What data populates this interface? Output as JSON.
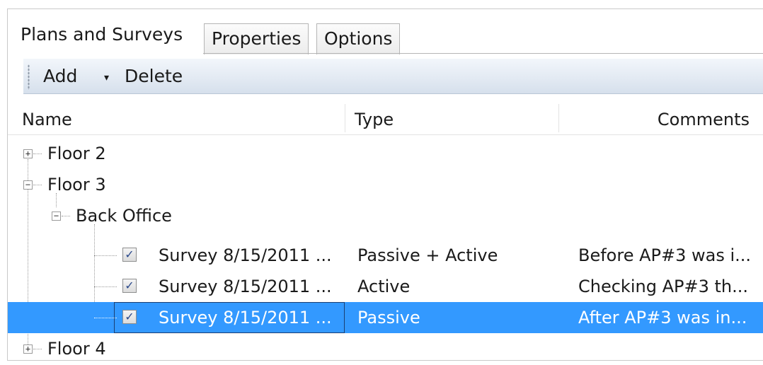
{
  "tabs": [
    {
      "label": "Plans and Surveys",
      "active": true
    },
    {
      "label": "Properties",
      "active": false
    },
    {
      "label": "Options",
      "active": false
    }
  ],
  "toolbar": {
    "add_label": "Add",
    "add_caret": "▾",
    "delete_label": "Delete"
  },
  "columns": {
    "name": "Name",
    "type": "Type",
    "comments": "Comments"
  },
  "tree": {
    "floor2": {
      "name": "Floor 2",
      "expander": "+"
    },
    "floor3": {
      "name": "Floor 3",
      "expander": "−"
    },
    "back_office": {
      "name": "Back Office",
      "expander": "−"
    },
    "surveys": [
      {
        "name": "Survey 8/15/2011 ...",
        "type": "Passive + Active",
        "comments": "Before AP#3 was i...",
        "checked": "✓"
      },
      {
        "name": "Survey 8/15/2011 ...",
        "type": "Active",
        "comments": "Checking AP#3 th...",
        "checked": "✓"
      },
      {
        "name": "Survey 8/15/2011 ...",
        "type": "Passive",
        "comments": "After AP#3 was in...",
        "checked": "✓"
      }
    ],
    "floor4": {
      "name": "Floor 4",
      "expander": "+"
    }
  },
  "colors": {
    "selection": "#3399ff",
    "toolbar": "#e3eaf3"
  }
}
